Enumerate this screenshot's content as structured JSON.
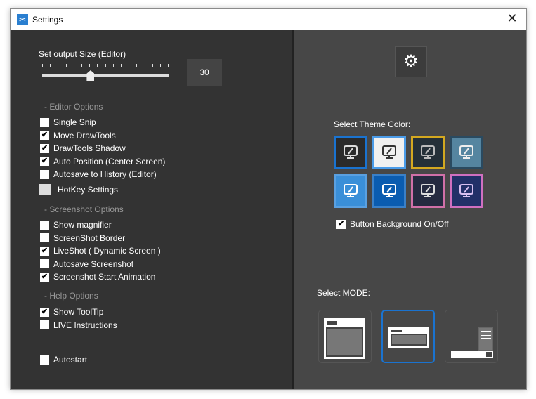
{
  "window": {
    "title": "Settings",
    "close": "✕"
  },
  "output_size": {
    "label": "Set output Size (Editor)",
    "value": "30",
    "slider_fraction": 0.38
  },
  "editor_options": {
    "header": "- Editor Options",
    "items": [
      {
        "label": "Single Snip",
        "checked": false
      },
      {
        "label": "Move DrawTools",
        "checked": true
      },
      {
        "label": "DrawTools Shadow",
        "checked": true
      },
      {
        "label": "Auto Position (Center Screen)",
        "checked": true
      },
      {
        "label": "Autosave to History (Editor)",
        "checked": false
      }
    ],
    "hotkey_label": "HotKey Settings"
  },
  "screenshot_options": {
    "header": "- Screenshot Options",
    "items": [
      {
        "label": "Show magnifier",
        "checked": false
      },
      {
        "label": "ScreenShot Border",
        "checked": false
      },
      {
        "label": "LiveShot ( Dynamic Screen )",
        "checked": true
      },
      {
        "label": "Autosave Screenshot",
        "checked": false
      },
      {
        "label": "Screenshot Start Animation",
        "checked": true
      }
    ]
  },
  "help_options": {
    "header": "- Help Options",
    "items": [
      {
        "label": "Show ToolTip",
        "checked": true
      },
      {
        "label": "LIVE Instructions",
        "checked": false
      }
    ]
  },
  "autostart": {
    "label": "Autostart",
    "checked": false
  },
  "theme": {
    "label": "Select Theme Color:",
    "tiles": [
      {
        "bg": "#2b2b2b",
        "border": "#1a73d0",
        "icon": "#ddd"
      },
      {
        "bg": "#f0f0f0",
        "border": "#4a9be8",
        "icon": "#333"
      },
      {
        "bg": "#253038",
        "border": "#d4a820",
        "icon": "#bbb"
      },
      {
        "bg": "#5585a0",
        "border": "#2a4a60",
        "icon": "#eee"
      },
      {
        "bg": "#3a8fd8",
        "border": "#5aa0e0",
        "icon": "#fff"
      },
      {
        "bg": "#0a5cb0",
        "border": "#3a80c8",
        "icon": "#fff"
      },
      {
        "bg": "#252a40",
        "border": "#d070a8",
        "icon": "#ddd"
      },
      {
        "bg": "#223068",
        "border": "#d070c0",
        "icon": "#d8c0f0"
      }
    ],
    "button_bg": {
      "label": "Button Background On/Off",
      "checked": true
    }
  },
  "mode": {
    "label": "Select MODE:",
    "selected": 1
  }
}
